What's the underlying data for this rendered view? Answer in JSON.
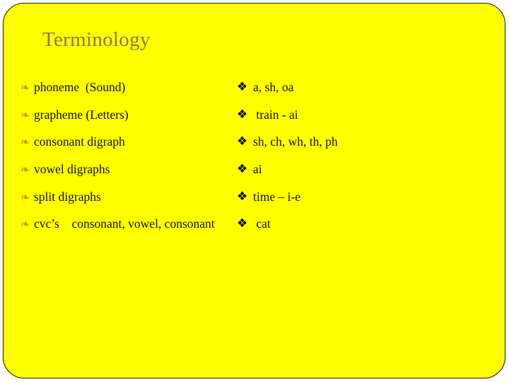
{
  "slide": {
    "title": "Terminology",
    "background_color": "#ffff00",
    "title_color": "#847e4f",
    "border_color": "#1a1a00",
    "left_bullet_color": "#d79008",
    "right_bullet_color": "#000000",
    "text_color": "#120f00"
  },
  "left_column": {
    "bullet_icon": "❧",
    "items": [
      {
        "text": "phoneme  (Sound)"
      },
      {
        "text": "grapheme (Letters)"
      },
      {
        "text": "consonant digraph"
      },
      {
        "text": "vowel digraphs"
      },
      {
        "text": "split digraphs"
      },
      {
        "text": "cvc’s    consonant, vowel, consonant"
      }
    ]
  },
  "right_column": {
    "bullet_icon": "❖",
    "items": [
      {
        "text": "a, sh, oa"
      },
      {
        "text": " train - ai"
      },
      {
        "text": "sh, ch, wh, th, ph"
      },
      {
        "text": "ai"
      },
      {
        "text": "time – i-e"
      },
      {
        "text": " cat"
      }
    ]
  }
}
